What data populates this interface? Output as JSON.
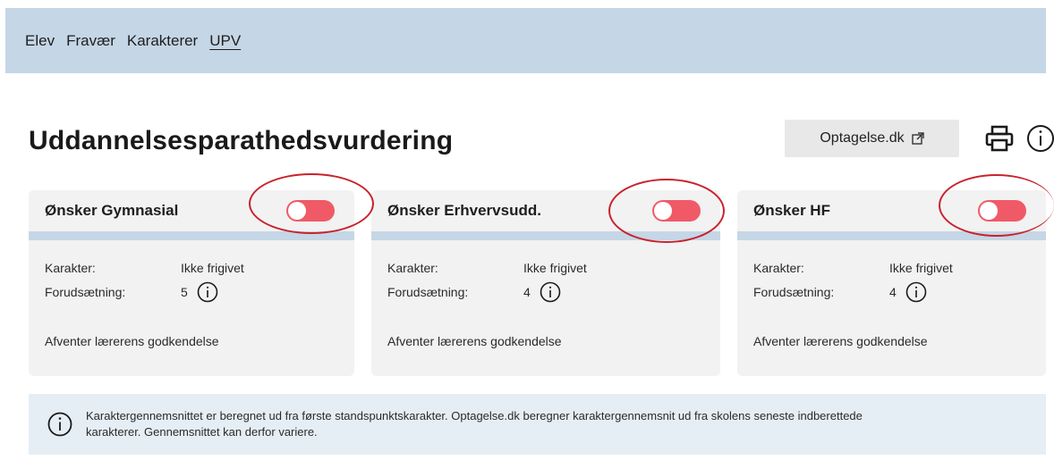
{
  "nav": {
    "items": [
      {
        "label": "Elev"
      },
      {
        "label": "Fravær"
      },
      {
        "label": "Karakterer"
      },
      {
        "label": "UPV"
      }
    ]
  },
  "page": {
    "title": "Uddannelsesparathedsvurdering",
    "optagelse_button": "Optagelse.dk"
  },
  "cards": [
    {
      "title": "Ønsker Gymnasial",
      "toggle_on": false,
      "karakter_label": "Karakter:",
      "karakter_value": "Ikke frigivet",
      "forudsaetning_label": "Forudsætning:",
      "forudsaetning_value": "5",
      "status": "Afventer lærerens godkendelse"
    },
    {
      "title": "Ønsker Erhvervsudd.",
      "toggle_on": false,
      "karakter_label": "Karakter:",
      "karakter_value": "Ikke frigivet",
      "forudsaetning_label": "Forudsætning:",
      "forudsaetning_value": "4",
      "status": "Afventer lærerens godkendelse"
    },
    {
      "title": "Ønsker HF",
      "toggle_on": false,
      "karakter_label": "Karakter:",
      "karakter_value": "Ikke frigivet",
      "forudsaetning_label": "Forudsætning:",
      "forudsaetning_value": "4",
      "status": "Afventer lærerens godkendelse"
    }
  ],
  "notice": {
    "line1": "Karaktergennemsnittet er beregnet ud fra første standspunktskarakter. Optagelse.dk beregner karaktergennemsnit ud fra skolens seneste indberettede",
    "line2": "karakterer. Gennemsnittet kan derfor variere."
  },
  "colors": {
    "nav_bg": "#c5d6e6",
    "toggle_off": "#f05a66",
    "annotation_ring": "#c8232c",
    "card_bg": "#f2f2f2",
    "notice_bg": "#e6eef5"
  },
  "icons": [
    "external-link-icon",
    "print-icon",
    "info-icon"
  ]
}
